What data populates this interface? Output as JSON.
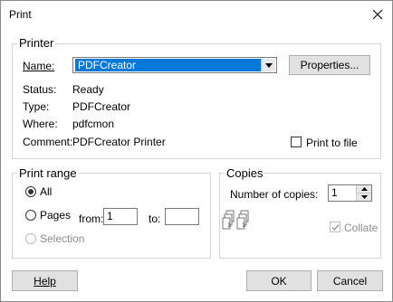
{
  "window": {
    "title": "Print"
  },
  "printer": {
    "legend": "Printer",
    "name_label": "Name:",
    "name_value": "PDFCreator",
    "properties_label": "Properties...",
    "status_label": "Status:",
    "status_value": "Ready",
    "type_label": "Type:",
    "type_value": "PDFCreator",
    "where_label": "Where:",
    "where_value": "pdfcmon",
    "comment_label": "Comment:",
    "comment_value": "PDFCreator Printer",
    "print_to_file_label": "Print to file",
    "print_to_file_checked": false
  },
  "print_range": {
    "legend": "Print range",
    "all_label": "All",
    "pages_label": "Pages",
    "from_label": "from:",
    "from_value": "1",
    "to_label": "to:",
    "to_value": "",
    "selection_label": "Selection",
    "selected": "all"
  },
  "copies": {
    "legend": "Copies",
    "number_label": "Number of copies:",
    "number_value": "1",
    "collate_label": "Collate",
    "collate_checked": true,
    "collate_disabled": true
  },
  "buttons": {
    "help": "Help",
    "ok": "OK",
    "cancel": "Cancel"
  },
  "icons": [
    "close-icon",
    "dropdown-arrow-icon",
    "spinner-up-icon",
    "spinner-down-icon",
    "collate-pages-icon",
    "checkmark-icon"
  ]
}
